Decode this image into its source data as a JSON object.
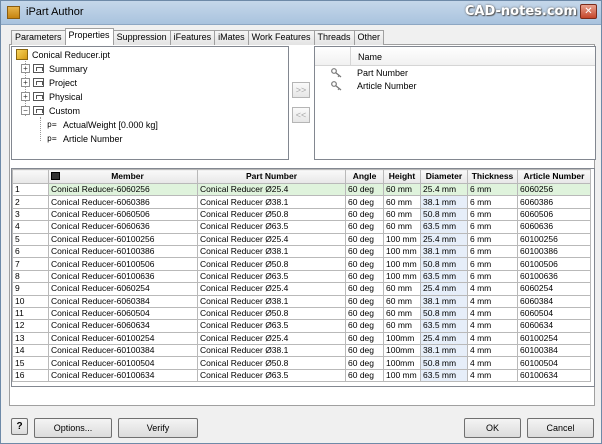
{
  "window": {
    "title": "iPart Author",
    "watermark": "CAD-notes.com"
  },
  "tabs": [
    {
      "label": "Parameters",
      "active": false
    },
    {
      "label": "Properties",
      "active": true
    },
    {
      "label": "Suppression",
      "active": false
    },
    {
      "label": "iFeatures",
      "active": false
    },
    {
      "label": "iMates",
      "active": false
    },
    {
      "label": "Work Features",
      "active": false
    },
    {
      "label": "Threads",
      "active": false
    },
    {
      "label": "Other",
      "active": false
    }
  ],
  "tree": {
    "root": "Conical Reducer.ipt",
    "groups": [
      "Summary",
      "Project",
      "Physical",
      "Custom"
    ],
    "custom_items": [
      {
        "prefix": "p=",
        "label": "ActualWeight [0.000 kg]"
      },
      {
        "prefix": "p=",
        "label": "Article Number"
      }
    ]
  },
  "move_buttons": {
    "add": ">>",
    "remove": "<<"
  },
  "name_list": {
    "header": "Name",
    "items": [
      "Part Number",
      "Article Number"
    ]
  },
  "grid": {
    "columns": [
      "",
      "Member",
      "Part Number",
      "Angle",
      "Height",
      "Diameter",
      "Thickness",
      "Article Number"
    ],
    "rows": [
      [
        "1",
        "Conical Reducer-6060256",
        "Conical Reducer Ø25.4",
        "60 deg",
        "60 mm",
        "25.4 mm",
        "6 mm",
        "6060256"
      ],
      [
        "2",
        "Conical Reducer-6060386",
        "Conical Reducer Ø38.1",
        "60 deg",
        "60 mm",
        "38.1 mm",
        "6 mm",
        "6060386"
      ],
      [
        "3",
        "Conical Reducer-6060506",
        "Conical Reducer Ø50.8",
        "60 deg",
        "60 mm",
        "50.8 mm",
        "6 mm",
        "6060506"
      ],
      [
        "4",
        "Conical Reducer-6060636",
        "Conical Reducer Ø63.5",
        "60 deg",
        "60 mm",
        "63.5 mm",
        "6 mm",
        "6060636"
      ],
      [
        "5",
        "Conical Reducer-60100256",
        "Conical Reducer Ø25.4",
        "60 deg",
        "100 mm",
        "25.4 mm",
        "6 mm",
        "60100256"
      ],
      [
        "6",
        "Conical Reducer-60100386",
        "Conical Reducer Ø38.1",
        "60 deg",
        "100 mm",
        "38.1 mm",
        "6 mm",
        "60100386"
      ],
      [
        "7",
        "Conical Reducer-60100506",
        "Conical Reducer Ø50.8",
        "60 deg",
        "100 mm",
        "50.8 mm",
        "6 mm",
        "60100506"
      ],
      [
        "8",
        "Conical Reducer-60100636",
        "Conical Reducer Ø63.5",
        "60 deg",
        "100 mm",
        "63.5 mm",
        "6 mm",
        "60100636"
      ],
      [
        "9",
        "Conical Reducer-6060254",
        "Conical Reducer Ø25.4",
        "60 deg",
        "60 mm",
        "25.4 mm",
        "4 mm",
        "6060254"
      ],
      [
        "10",
        "Conical Reducer-6060384",
        "Conical Reducer Ø38.1",
        "60 deg",
        "60 mm",
        "38.1 mm",
        "4 mm",
        "6060384"
      ],
      [
        "11",
        "Conical Reducer-6060504",
        "Conical Reducer Ø50.8",
        "60 deg",
        "60 mm",
        "50.8 mm",
        "4 mm",
        "6060504"
      ],
      [
        "12",
        "Conical Reducer-6060634",
        "Conical Reducer Ø63.5",
        "60 deg",
        "60 mm",
        "63.5 mm",
        "4 mm",
        "6060634"
      ],
      [
        "13",
        "Conical Reducer-60100254",
        "Conical Reducer Ø25.4",
        "60 deg",
        "100mm",
        "25.4 mm",
        "4 mm",
        "60100254"
      ],
      [
        "14",
        "Conical Reducer-60100384",
        "Conical Reducer Ø38.1",
        "60 deg",
        "100mm",
        "38.1 mm",
        "4 mm",
        "60100384"
      ],
      [
        "15",
        "Conical Reducer-60100504",
        "Conical Reducer Ø50.8",
        "60 deg",
        "100mm",
        "50.8 mm",
        "4 mm",
        "60100504"
      ],
      [
        "16",
        "Conical Reducer-60100634",
        "Conical Reducer Ø63.5",
        "60 deg",
        "100 mm",
        "63.5 mm",
        "4 mm",
        "60100634"
      ]
    ],
    "selected_row": 1
  },
  "buttons": {
    "help": "?",
    "options": "Options...",
    "verify": "Verify",
    "ok": "OK",
    "cancel": "Cancel"
  },
  "colors": {
    "selected_row": "#dff3dc",
    "shaded_cell": "#e6eef9",
    "title_bar": "#b8cde4"
  }
}
